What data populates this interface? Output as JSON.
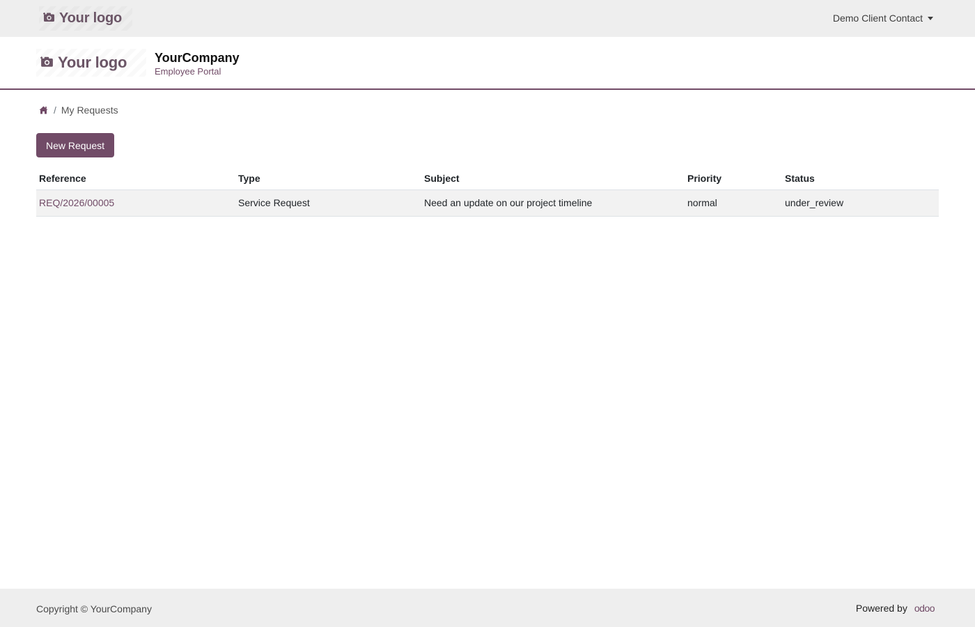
{
  "topbar": {
    "logo_text": "Your logo",
    "user_menu_label": "Demo Client Contact"
  },
  "header": {
    "logo_text": "Your logo",
    "company_name": "YourCompany",
    "portal_name": "Employee Portal"
  },
  "breadcrumb": {
    "separator": "/",
    "current": "My Requests"
  },
  "actions": {
    "new_request_label": "New Request"
  },
  "table": {
    "columns": [
      "Reference",
      "Type",
      "Subject",
      "Priority",
      "Status"
    ],
    "rows": [
      {
        "reference": "REQ/2026/00005",
        "type": "Service Request",
        "subject": "Need an update on our project timeline",
        "priority": "normal",
        "status": "under_review"
      }
    ]
  },
  "footer": {
    "copyright": "Copyright © YourCompany",
    "powered_by": "Powered by",
    "brand": "odoo"
  },
  "colors": {
    "primary": "#714b67",
    "topbar_bg": "#eeeeee",
    "row_bg": "#f2f2f2"
  },
  "icons": {
    "logo": "camera-icon",
    "home": "home-icon",
    "dropdown": "caret-down-icon"
  }
}
